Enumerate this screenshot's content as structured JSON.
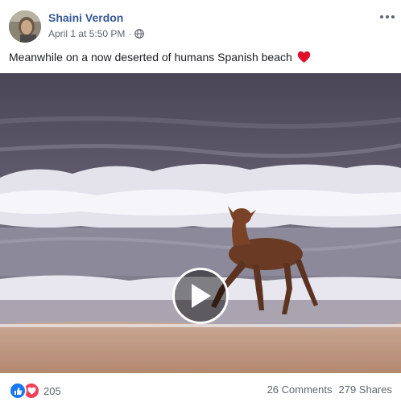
{
  "post": {
    "author": "Shaini Verdon",
    "date": "April 1 at 5:50 PM",
    "separator": "·",
    "caption": "Meanwhile on a now deserted of humans Spanish beach",
    "caption_emoji": "red-heart-icon",
    "privacy_icon": "globe-icon",
    "more_icon": "more-options-icon"
  },
  "video": {
    "play_icon": "play-icon",
    "description_visual": "deer-on-beach"
  },
  "footer": {
    "reaction_icons": [
      "like-icon",
      "love-icon"
    ],
    "reaction_count": "205",
    "comments": "26 Comments",
    "shares": "279 Shares"
  },
  "colors": {
    "author_link": "#385898",
    "meta_text": "#616770",
    "like_blue": "#1877f2",
    "love_red": "#f33e58"
  }
}
